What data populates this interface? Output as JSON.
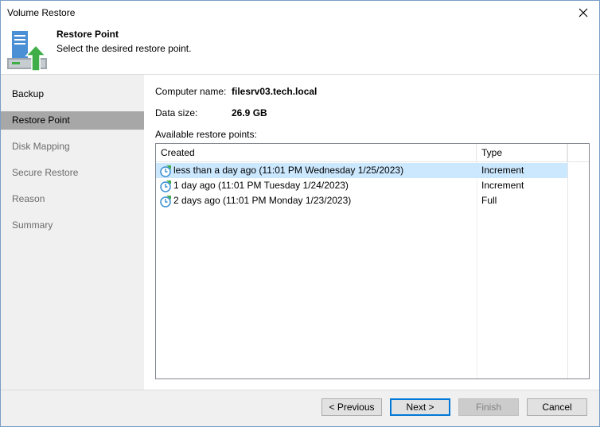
{
  "window": {
    "title": "Volume Restore"
  },
  "header": {
    "title": "Restore Point",
    "subtitle": "Select the desired restore point."
  },
  "nav": {
    "items": [
      {
        "label": "Backup",
        "state": "done"
      },
      {
        "label": "Restore Point",
        "state": "active"
      },
      {
        "label": "Disk Mapping",
        "state": "pending"
      },
      {
        "label": "Secure Restore",
        "state": "pending"
      },
      {
        "label": "Reason",
        "state": "pending"
      },
      {
        "label": "Summary",
        "state": "pending"
      }
    ]
  },
  "details": {
    "computer_name_label": "Computer name:",
    "computer_name_value": "filesrv03.tech.local",
    "data_size_label": "Data size:",
    "data_size_value": "26.9 GB",
    "list_label": "Available restore points:"
  },
  "table": {
    "columns": [
      "Created",
      "Type"
    ],
    "rows": [
      {
        "created": "less than a day ago (11:01 PM Wednesday 1/25/2023)",
        "type": "Increment",
        "selected": true
      },
      {
        "created": "1 day ago (11:01 PM Tuesday 1/24/2023)",
        "type": "Increment",
        "selected": false
      },
      {
        "created": "2 days ago (11:01 PM Monday 1/23/2023)",
        "type": "Full",
        "selected": false
      }
    ]
  },
  "buttons": {
    "previous": "< Previous",
    "next": "Next >",
    "finish": "Finish",
    "cancel": "Cancel"
  },
  "icons": {
    "close": "close-icon",
    "header": "volume-restore-icon",
    "restore_point": "restore-point-icon"
  },
  "colors": {
    "selection": "#cce8ff",
    "nav_active": "#a7a7a7",
    "accent_green": "#3fae49",
    "accent_blue": "#0078d7"
  }
}
